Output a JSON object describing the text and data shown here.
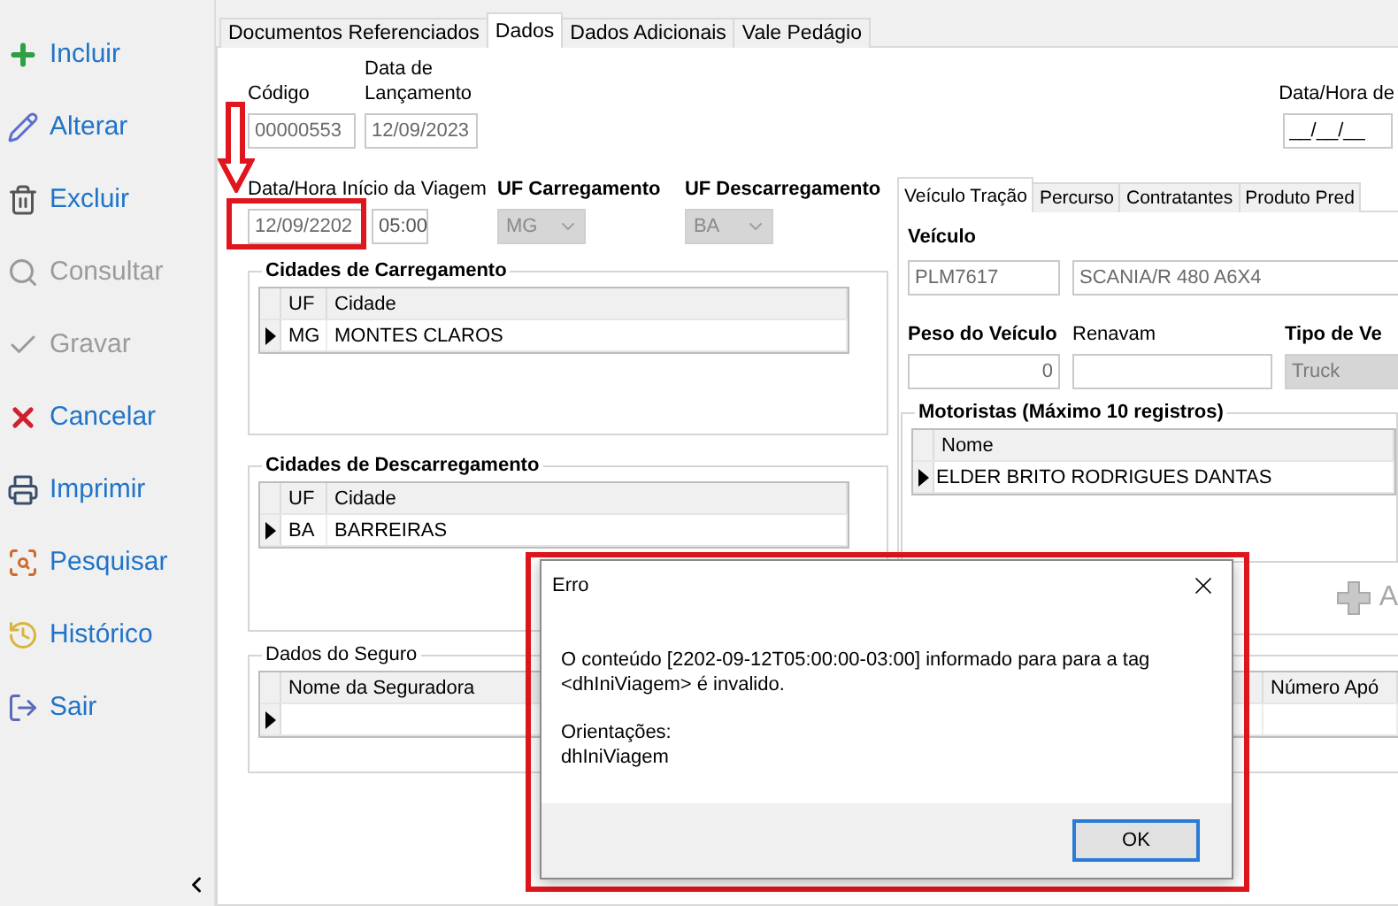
{
  "sidebar": {
    "items": [
      {
        "label": "Incluir",
        "disabled": false
      },
      {
        "label": "Alterar",
        "disabled": false
      },
      {
        "label": "Excluir",
        "disabled": false
      },
      {
        "label": "Consultar",
        "disabled": true
      },
      {
        "label": "Gravar",
        "disabled": true
      },
      {
        "label": "Cancelar",
        "disabled": false
      },
      {
        "label": "Imprimir",
        "disabled": false
      },
      {
        "label": "Pesquisar",
        "disabled": false
      },
      {
        "label": "Histórico",
        "disabled": false
      },
      {
        "label": "Sair",
        "disabled": false
      }
    ]
  },
  "tabs": [
    {
      "label": "Documentos Referenciados",
      "selected": false
    },
    {
      "label": "Dados",
      "selected": true
    },
    {
      "label": "Dados Adicionais",
      "selected": false
    },
    {
      "label": "Vale Pedágio",
      "selected": false
    }
  ],
  "codigo": {
    "label": "Código",
    "value": "00000553"
  },
  "data_lancamento": {
    "label": "Data de Lançamento",
    "value": "12/09/2023"
  },
  "data_hora_fim": {
    "label": "Data/Hora de",
    "value": "__/__/__"
  },
  "inicio_viagem": {
    "label": "Data/Hora Início da Viagem",
    "date": "12/09/2202",
    "time": "05:00"
  },
  "uf_carregamento": {
    "label": "UF Carregamento",
    "value": "MG",
    "disabled": true
  },
  "uf_descarregamento": {
    "label": "UF Descarregamento",
    "value": "BA",
    "disabled": true
  },
  "cidades_carregamento": {
    "title": "Cidades de Carregamento",
    "columns": [
      "UF",
      "Cidade"
    ],
    "rows": [
      {
        "uf": "MG",
        "cidade": "MONTES CLAROS",
        "selected": true
      }
    ]
  },
  "cidades_descarregamento": {
    "title": "Cidades de Descarregamento",
    "columns": [
      "UF",
      "Cidade"
    ],
    "rows": [
      {
        "uf": "BA",
        "cidade": "BARREIRAS",
        "selected": true
      }
    ]
  },
  "vehicle_tabs": [
    {
      "label": "Veículo Tração",
      "selected": true
    },
    {
      "label": "Percurso",
      "selected": false
    },
    {
      "label": "Contratantes",
      "selected": false
    },
    {
      "label": "Produto Pred",
      "selected": false
    }
  ],
  "veiculo": {
    "label": "Veículo",
    "placa": "PLM7617",
    "modelo": "SCANIA/R 480 A6X4"
  },
  "peso": {
    "label": "Peso do Veículo",
    "value": "0"
  },
  "renavam": {
    "label": "Renavam"
  },
  "tipo": {
    "label": "Tipo de Ve",
    "value": "Truck",
    "disabled": true
  },
  "motoristas": {
    "title": "Motoristas (Máximo 10 registros)",
    "columns": [
      "Nome"
    ],
    "rows": [
      {
        "nome": "ELDER BRITO RODRIGUES DANTAS",
        "selected": true
      }
    ]
  },
  "add_button": {
    "label": "A",
    "disabled": true
  },
  "seguro": {
    "title": "Dados do Seguro",
    "columns": [
      "Nome da Seguradora",
      "Número Apó"
    ],
    "rows": [
      {
        "selected": true
      }
    ]
  },
  "dialog": {
    "title": "Erro",
    "paragraphs": [
      "O conteúdo [2202-09-12T05:00:00-03:00] informado para para a tag\n<dhIniViagem> é invalido.",
      "Orientações:\ndhIniViagem"
    ],
    "ok": "OK"
  }
}
